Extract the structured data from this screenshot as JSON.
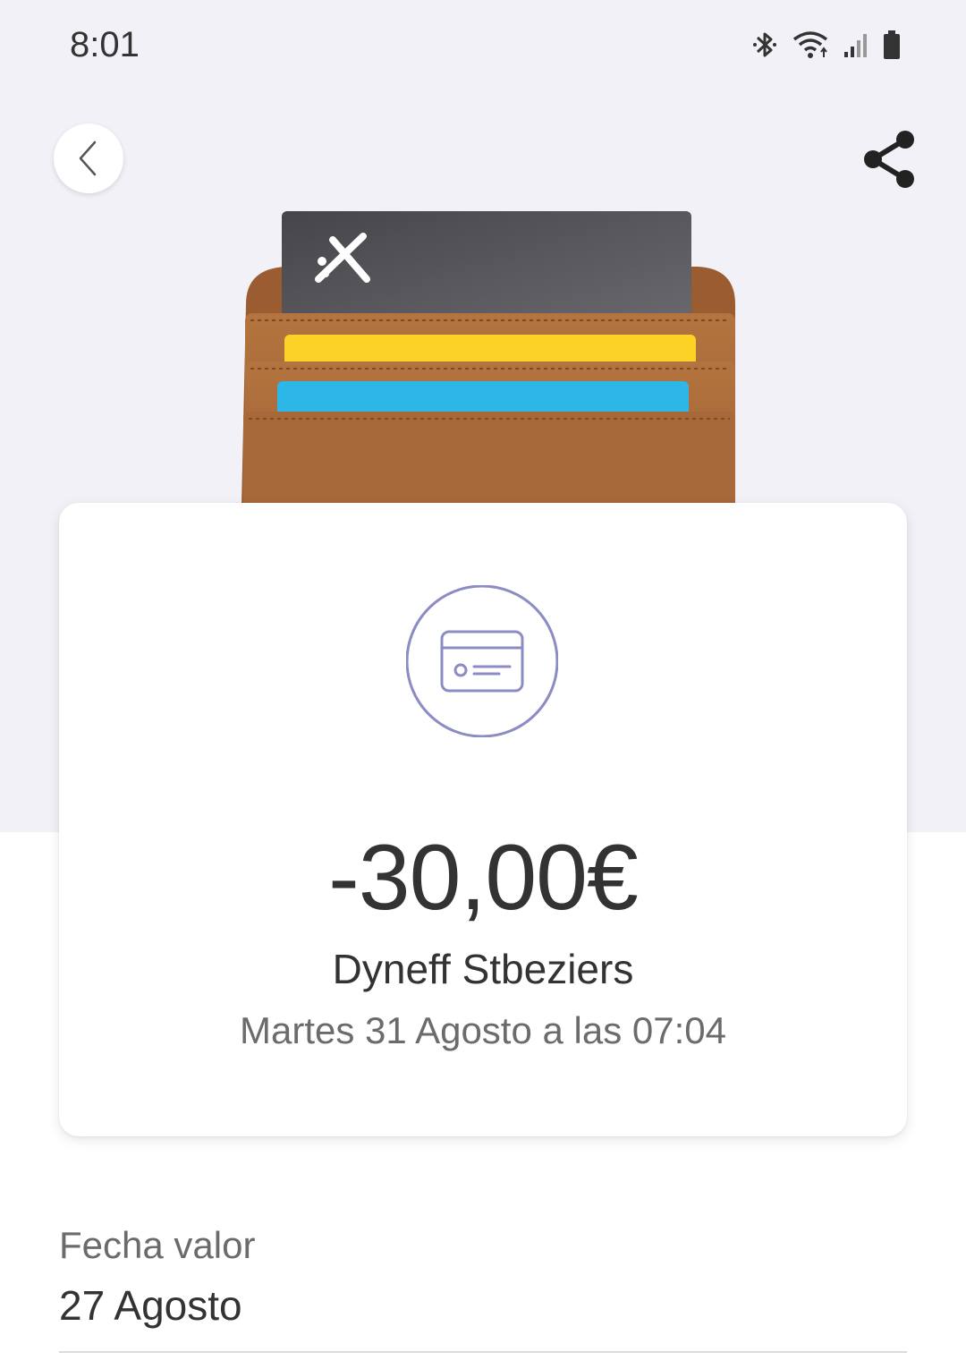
{
  "status_bar": {
    "time": "8:01",
    "icons": [
      "bluetooth-icon",
      "wifi-icon",
      "signal-icon",
      "battery-icon"
    ]
  },
  "header": {
    "back_icon": "chevron-left-icon",
    "share_icon": "share-icon"
  },
  "hero": {
    "illustration": "wallet-with-cards",
    "card_colors": [
      "#545458",
      "#fdd226",
      "#2db7e6"
    ],
    "wallet_color": "#a8693a"
  },
  "transaction": {
    "icon": "credit-card-icon",
    "amount": "-30,00€",
    "merchant": "Dyneff Stbeziers",
    "datetime": "Martes 31 Agosto a las 07:04"
  },
  "details": {
    "value_date_label": "Fecha valor",
    "value_date": "27 Agosto"
  },
  "colors": {
    "background_top": "#f1f1f7",
    "accent_icon": "#8c8cc4",
    "text_primary": "#333333",
    "text_secondary": "#6b6b6b"
  }
}
